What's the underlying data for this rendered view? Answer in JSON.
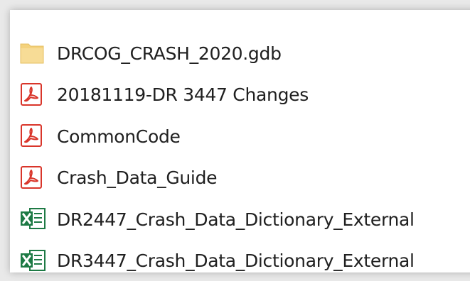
{
  "files": [
    {
      "name": "DRCOG_CRASH_2020.gdb",
      "icon": "folder-icon",
      "type": "folder"
    },
    {
      "name": "20181119-DR 3447 Changes",
      "icon": "pdf-icon",
      "type": "pdf"
    },
    {
      "name": "CommonCode",
      "icon": "pdf-icon",
      "type": "pdf"
    },
    {
      "name": "Crash_Data_Guide",
      "icon": "pdf-icon",
      "type": "pdf"
    },
    {
      "name": "DR2447_Crash_Data_Dictionary_External",
      "icon": "excel-icon",
      "type": "excel"
    },
    {
      "name": "DR3447_Crash_Data_Dictionary_External",
      "icon": "excel-icon",
      "type": "excel"
    }
  ],
  "colors": {
    "folder": "#f3d27b",
    "pdf": "#d9352a",
    "excel": "#1e7a45",
    "text": "#202020"
  }
}
